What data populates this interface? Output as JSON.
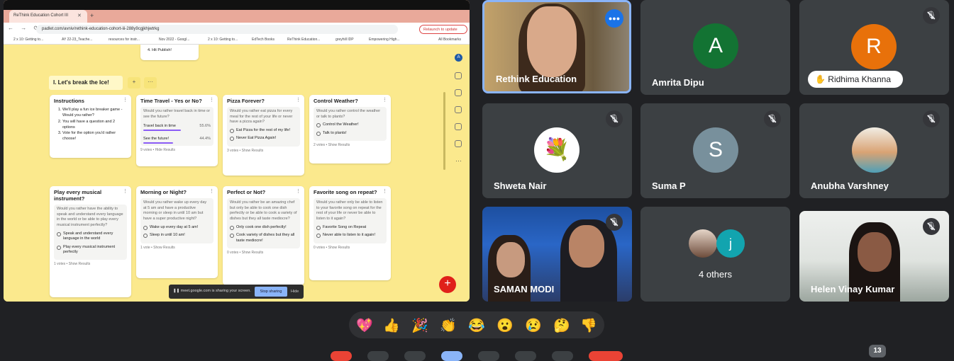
{
  "browser": {
    "tab_title": "ReThink Education Cohort III",
    "url": "padlet.com/avniv/rethink-education-cohort-iii-288y9cgjkhjwtrkg",
    "relaunch": "Relaunch to update",
    "bookmarks": [
      "2 x 10: Getting to...",
      "AY 22-23_Teache...",
      "resources for instr...",
      "Nov 2022 - Googl...",
      "2 x 10: Getting to...",
      "EdTech Books",
      "ReThink Education...",
      "greyhill IDP",
      "Empowering High...",
      "All Bookmarks"
    ]
  },
  "padlet": {
    "prev_card_text": "4. Hit Publish!",
    "section_title": "I. Let's break the Ice!",
    "section_add": "+",
    "section_more": "···",
    "cards": {
      "instructions": {
        "title": "Instructions",
        "items": [
          "We'll play a fun ice breaker game - Would you rather?",
          "You will have a question and 2 options",
          "Vote for the option you'd rather choose!"
        ]
      },
      "time": {
        "title": "Time Travel - Yes or No?",
        "question": "Would you rather travel back in time or see the future?",
        "opt1": "Travel back in time",
        "pct1": "55.6%",
        "opt2": "See the future!",
        "pct2": "44.4%",
        "votes": "9 votes",
        "action": "Hide Results"
      },
      "pizza": {
        "title": "Pizza Forever?",
        "question": "Would you rather eat pizza for every meal for the rest of your life or never have a pizza again?",
        "opt1": "Eat Pizza for the rest of my life!",
        "opt2": "Never Eat Pizza Again!",
        "votes": "3 votes",
        "action": "Show Results"
      },
      "weather": {
        "title": "Control Weather?",
        "question": "Would you rather control the weather or talk to plants?",
        "opt1": "Control the Weather!",
        "opt2": "Talk to plants!",
        "votes": "2 votes",
        "action": "Show Results"
      },
      "music": {
        "title": "Play every musical instrument?",
        "question": "Would you rather have the ability to speak and understand every language in the world or be able to play every musical instrument perfectly?",
        "opt1": "Speak and understand every language in the world",
        "opt2": "Play every musical instrument perfectly",
        "votes": "1 votes",
        "action": "Show Results"
      },
      "morning": {
        "title": "Morning or Night?",
        "question": "Would you rather wake up every day at 5 am and have a productive morning or sleep in until 10 am but have a super productive night?",
        "opt1": "Wake up every day at 5 am!",
        "opt2": "Sleep in until 10 am!",
        "votes": "1 vote",
        "action": "Show Results"
      },
      "perfect": {
        "title": "Perfect or Not?",
        "question": "Would you rather be an amazing chef but only be able to cook one dish perfectly or be able to cook a variety of dishes but they all taste mediocre?",
        "opt1": "Only cook one dish perfectly!",
        "opt2": "Cook variety of dishes but they all taste mediocre!",
        "votes": "0 votes",
        "action": "Show Results"
      },
      "song": {
        "title": "Favorite song on repeat?",
        "question": "Would you rather only be able to listen to your favorite song on repeat for the rest of your life or never be able to listen to it again?",
        "opt1": "Favorite Song on Repeat",
        "opt2": "Never able to listen to it again!",
        "votes": "0 votes",
        "action": "Show Results"
      }
    },
    "fab": "+",
    "avatar_letter": "A"
  },
  "share_bar": {
    "text": "meet.google.com is sharing your screen.",
    "stop": "Stop sharing",
    "hide": "Hide"
  },
  "participants": {
    "rethink": {
      "name": "Rethink Education"
    },
    "amrita": {
      "name": "Amrita Dipu",
      "initial": "A",
      "color": "#137333"
    },
    "ridhima": {
      "name": "Ridhima Khanna",
      "initial": "R",
      "color": "#e8710a"
    },
    "shweta": {
      "name": "Shweta Nair"
    },
    "suma": {
      "name": "Suma P",
      "initial": "S",
      "color": "#78909c"
    },
    "anubha": {
      "name": "Anubha Varshney"
    },
    "saman": {
      "name": "SAMAN MODI"
    },
    "others": {
      "label": "4 others",
      "initial": "j",
      "color": "#12a4af"
    },
    "helen": {
      "name": "Helen Vinay Kumar"
    }
  },
  "reactions": [
    "💖",
    "👍",
    "🎉",
    "👏",
    "😂",
    "😮",
    "😢",
    "🤔",
    "👎"
  ],
  "participant_count": "13"
}
